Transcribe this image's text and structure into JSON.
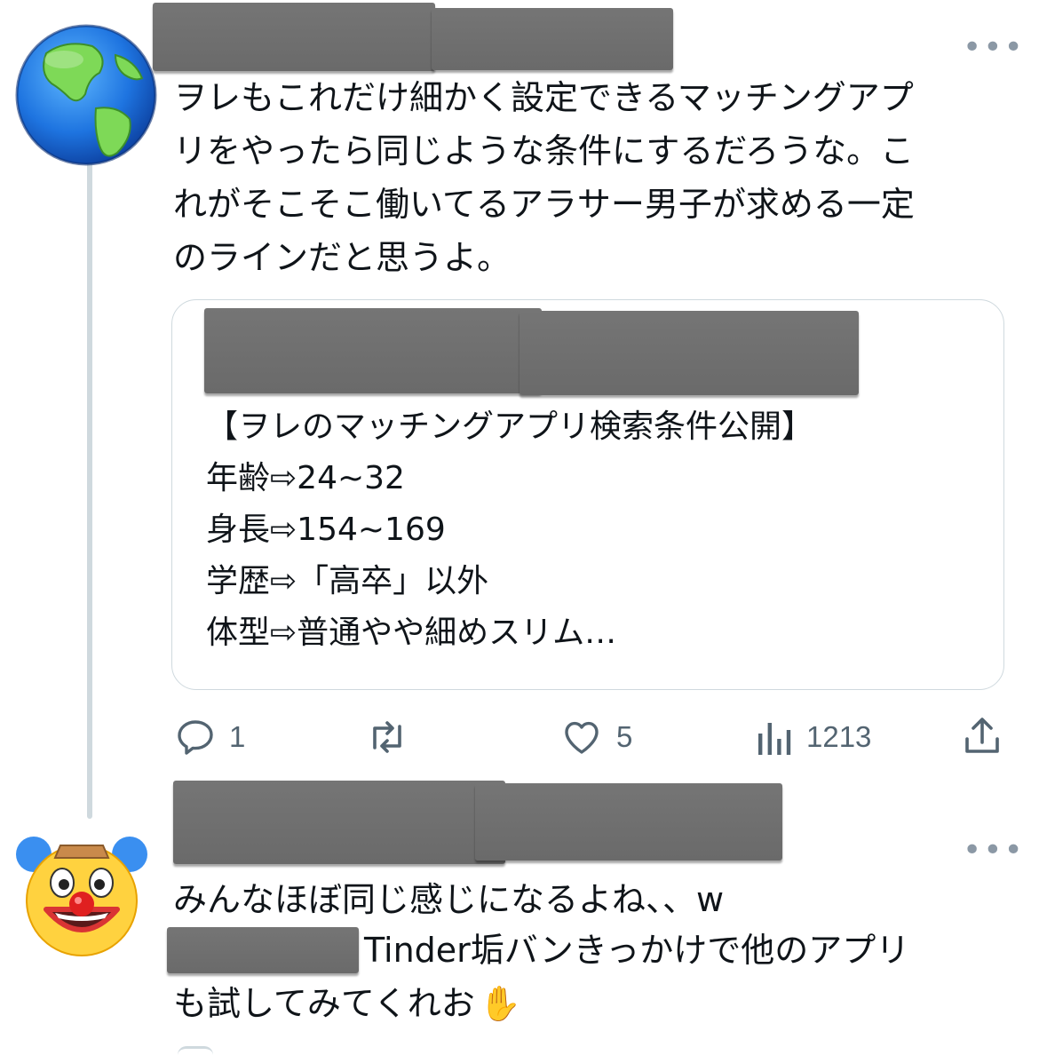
{
  "tweet1": {
    "avatar_icon": "globe-americas-emoji",
    "more_label": "•••",
    "text": "ヲレもこれだけ細かく設定できるマッチングアプリをやったら同じような条件にするだろうな。これがそこそこ働いてるアラサー男子が求める一定のラインだと思うよ。",
    "text_lines": [
      "ヲレもこれだけ細かく設定できるマッチングアプ",
      "リをやったら同じような条件にするだろうな。こ",
      "れがそこそこ働いてるアラサー男子が求める一定",
      "のラインだと思うよ。"
    ],
    "quote": {
      "lines": [
        "【ヲレのマッチングアプリ検索条件公開】",
        "年齢⇨24~32",
        "身長⇨154~169",
        "学歴⇨「高卒」以外",
        "体型⇨普通やや細めスリム…"
      ]
    },
    "actions": {
      "reply_count": "1",
      "retweet_count": "",
      "like_count": "5",
      "views_count": "1213"
    }
  },
  "tweet2": {
    "avatar_icon": "clown-face-emoji",
    "more_label": "•••",
    "line1": "みんなほぼ同じ感じになるよね、、w",
    "line2_text": "Tinder垢バンきっかけで他のアプリ",
    "line3_text": "も試してみてくれお",
    "emoji": "✋"
  },
  "colors": {
    "text": "#0f1419",
    "icon_gray": "#536471",
    "border": "#cfd9de",
    "redaction": "#707070"
  }
}
